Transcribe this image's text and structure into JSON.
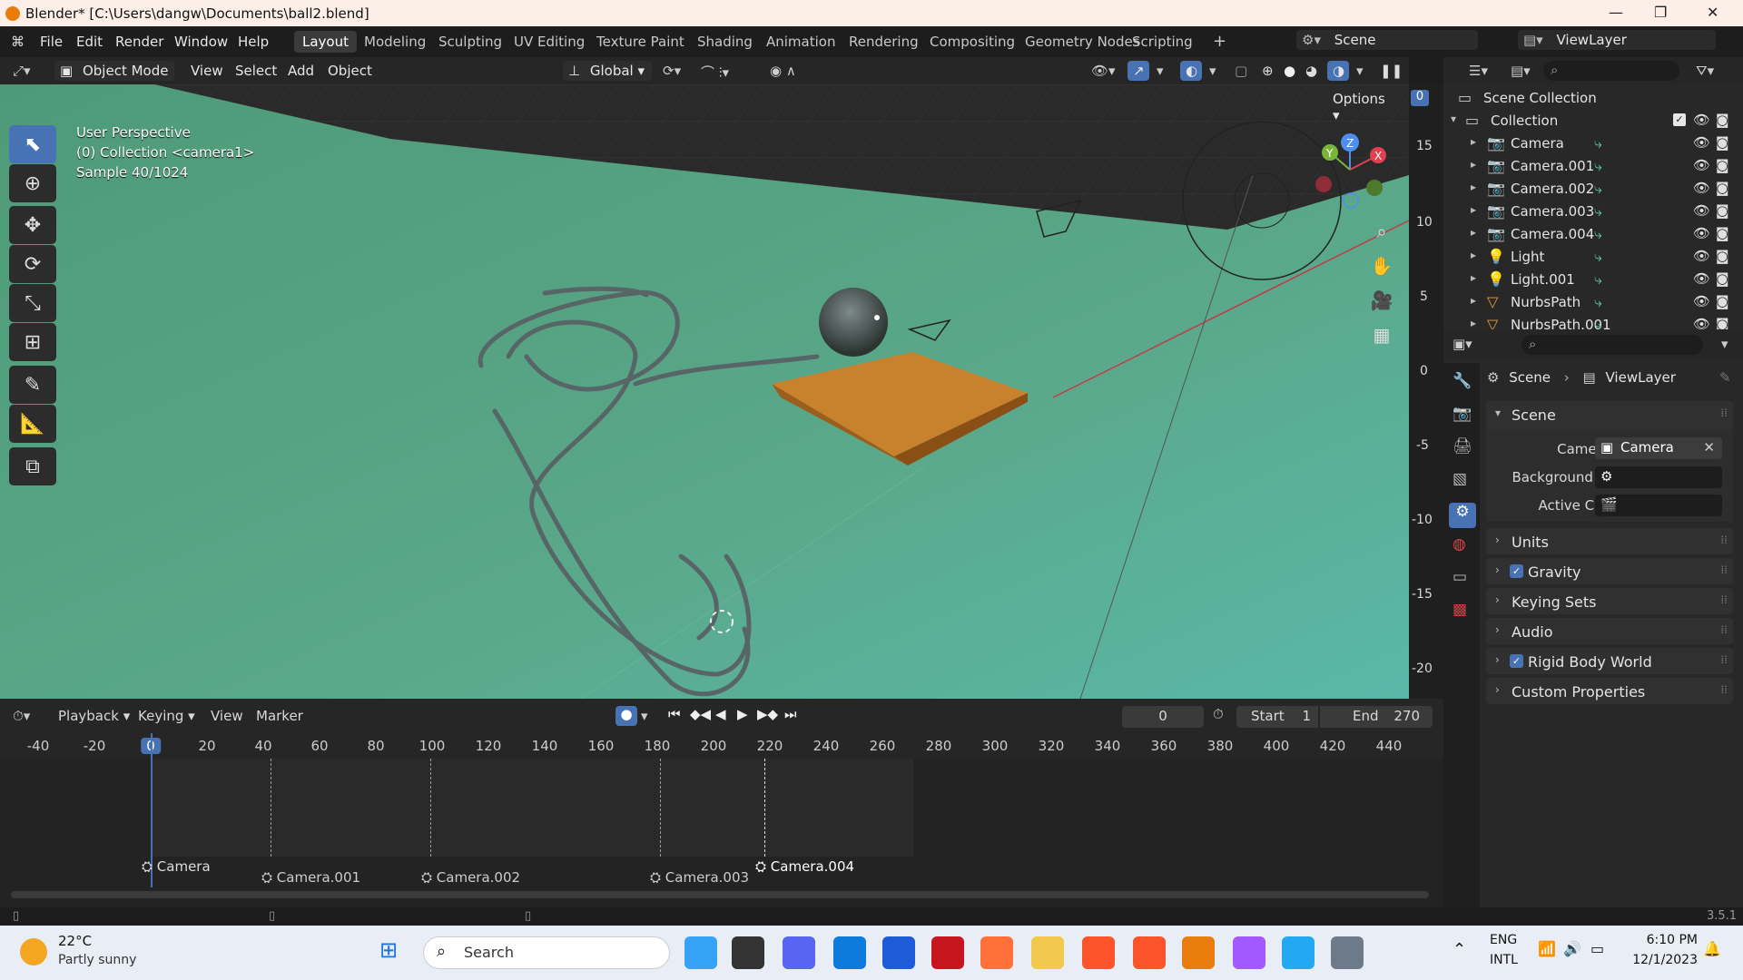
{
  "window": {
    "title": "Blender* [C:\\Users\\dangw\\Documents\\ball2.blend]"
  },
  "menu": [
    "File",
    "Edit",
    "Render",
    "Window",
    "Help"
  ],
  "workspaces": [
    "Layout",
    "Modeling",
    "Sculpting",
    "UV Editing",
    "Texture Paint",
    "Shading",
    "Animation",
    "Rendering",
    "Compositing",
    "Geometry Nodes",
    "Scripting"
  ],
  "scene_selector": "Scene",
  "viewlayer_selector": "ViewLayer",
  "viewport_header": {
    "mode": "Object Mode",
    "menus": [
      "View",
      "Select",
      "Add",
      "Object"
    ],
    "orientation": "Global",
    "options": "Options"
  },
  "viewport": {
    "line1": "User Perspective",
    "line2": "(0) Collection <camera1>",
    "line3": "Sample 40/1024",
    "ruler": [
      "15",
      "10",
      "5",
      "0",
      "-5",
      "-10",
      "-15",
      "-20"
    ],
    "ruler_top": "0",
    "gizmo": {
      "x": "X",
      "y": "Y",
      "z": "Z"
    }
  },
  "outliner": {
    "root": "Scene Collection",
    "collection": "Collection",
    "items": [
      {
        "name": "Camera",
        "icon": "camera-icon"
      },
      {
        "name": "Camera.001",
        "icon": "camera-icon"
      },
      {
        "name": "Camera.002",
        "icon": "camera-icon"
      },
      {
        "name": "Camera.003",
        "icon": "camera-icon"
      },
      {
        "name": "Camera.004",
        "icon": "camera-icon"
      },
      {
        "name": "Light",
        "icon": "light-icon"
      },
      {
        "name": "Light.001",
        "icon": "light-icon"
      },
      {
        "name": "NurbsPath",
        "icon": "curve-icon"
      },
      {
        "name": "NurbsPath.001",
        "icon": "curve-icon"
      }
    ]
  },
  "properties": {
    "breadcrumb_scene": "Scene",
    "breadcrumb_viewlayer": "ViewLayer",
    "scene_panel": "Scene",
    "camera_label": "Camera",
    "camera_value": "Camera",
    "background_label": "Background ...",
    "active_clip_label": "Active Clip",
    "panels": [
      "Units",
      "Gravity",
      "Keying Sets",
      "Audio",
      "Rigid Body World",
      "Custom Properties"
    ]
  },
  "timeline": {
    "menus": [
      "Playback",
      "Keying",
      "View",
      "Marker"
    ],
    "current_frame": "0",
    "start_label": "Start",
    "start": "1",
    "end_label": "End",
    "end": "270",
    "ruler": [
      "-40",
      "-20",
      "0",
      "20",
      "40",
      "60",
      "80",
      "100",
      "120",
      "140",
      "160",
      "180",
      "200",
      "220",
      "240",
      "260",
      "280",
      "300",
      "320",
      "340",
      "360",
      "380",
      "400",
      "420",
      "440"
    ],
    "markers": [
      "Camera",
      "Camera.001",
      "Camera.002",
      "Camera.003",
      "Camera.004"
    ]
  },
  "status": {
    "version": "3.5.1"
  },
  "taskbar": {
    "weather_temp": "22°C",
    "weather_desc": "Partly sunny",
    "search": "Search",
    "lang1": "ENG",
    "lang2": "INTL",
    "time": "6:10 PM",
    "date": "12/1/2023"
  },
  "colors": {
    "accent": "#4772b3",
    "ground": "#5aa88a",
    "cube": "#c8812d",
    "blender_orange": "#e87d0d"
  }
}
